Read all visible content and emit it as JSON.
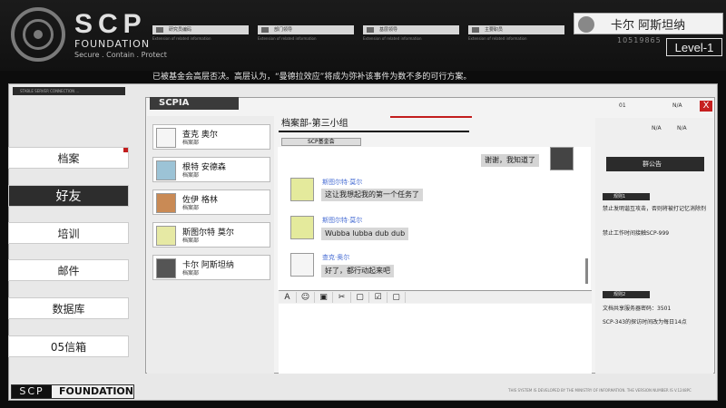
{
  "header": {
    "logo": {
      "scp": "SCP",
      "foundation": "FOUNDATION",
      "motto": "Secure . Contain . Protect"
    },
    "user_name": "卡尔 阿斯坦纳",
    "user_id": "10519865",
    "level": "Level-1",
    "fields": [
      {
        "label": "研究员编码",
        "sub": "Extension of related information"
      },
      {
        "label": "部门领导",
        "sub": "Extension of related information"
      },
      {
        "label": "基层领导",
        "sub": "Extension of related information"
      },
      {
        "label": "主要职员",
        "sub": "Extension of related information"
      }
    ]
  },
  "notice": "已被基金会高层否决。高层认为，“曼德拉效应”将成为弥补该事件为数不多的可行方案。",
  "connection_text": "STABLE SERVER CONNECTION ...",
  "sidebar": {
    "items": [
      {
        "label": "档案",
        "active": false
      },
      {
        "label": "好友",
        "active": true
      },
      {
        "label": "培训",
        "active": false
      },
      {
        "label": "邮件",
        "active": false
      },
      {
        "label": "数据库",
        "active": false
      },
      {
        "label": "05信箱",
        "active": false
      }
    ]
  },
  "window": {
    "title": "SCPIA",
    "top_tabs": [
      "01",
      "N/A"
    ],
    "right_tabs": [
      "N/A",
      "N/A"
    ],
    "close": "X"
  },
  "contacts": [
    {
      "name": "查克 奥尔",
      "dept": "档案部"
    },
    {
      "name": "根特 安德森",
      "dept": "档案部"
    },
    {
      "name": "佐伊 格林",
      "dept": "档案部"
    },
    {
      "name": "斯图尔特 莫尔",
      "dept": "档案部"
    },
    {
      "name": "卡尔 阿斯坦纳",
      "dept": "档案部"
    }
  ],
  "chat": {
    "title": "档案部-第三小组",
    "subtitle": "SCP基金会",
    "messages": [
      {
        "from": "me",
        "text": "谢谢，我知道了"
      },
      {
        "from": "斯图尔特·莫尔",
        "text": "这让我想起我的第一个任务了"
      },
      {
        "from": "斯图尔特·莫尔",
        "text": "Wubba lubba dub dub"
      },
      {
        "from": "查克·奥尔",
        "text": "好了，都行动起来吧"
      }
    ],
    "tools": [
      "A",
      "☺",
      "▣",
      "✂",
      "▢",
      "☑",
      "▢"
    ]
  },
  "board": {
    "title": "群公告",
    "rule1": "规则1",
    "rule1_lines": [
      "禁止发明谐互攻击，否则将被打记忆消除剂",
      "禁止工作时间接触SCP-999"
    ],
    "rule2": "规则2",
    "rule2_lines": [
      "文档共享服务器密码：3501",
      "SCP-343的探访时间改为每日14点"
    ]
  },
  "footer": {
    "a": "SCP",
    "b": "FOUNDATION",
    "system_text": "THIS SYSTEM IS DEVELOPED BY THE MINISTRY OF INFORMATION. THE VERSION NUMBER IS V.1248PC"
  }
}
